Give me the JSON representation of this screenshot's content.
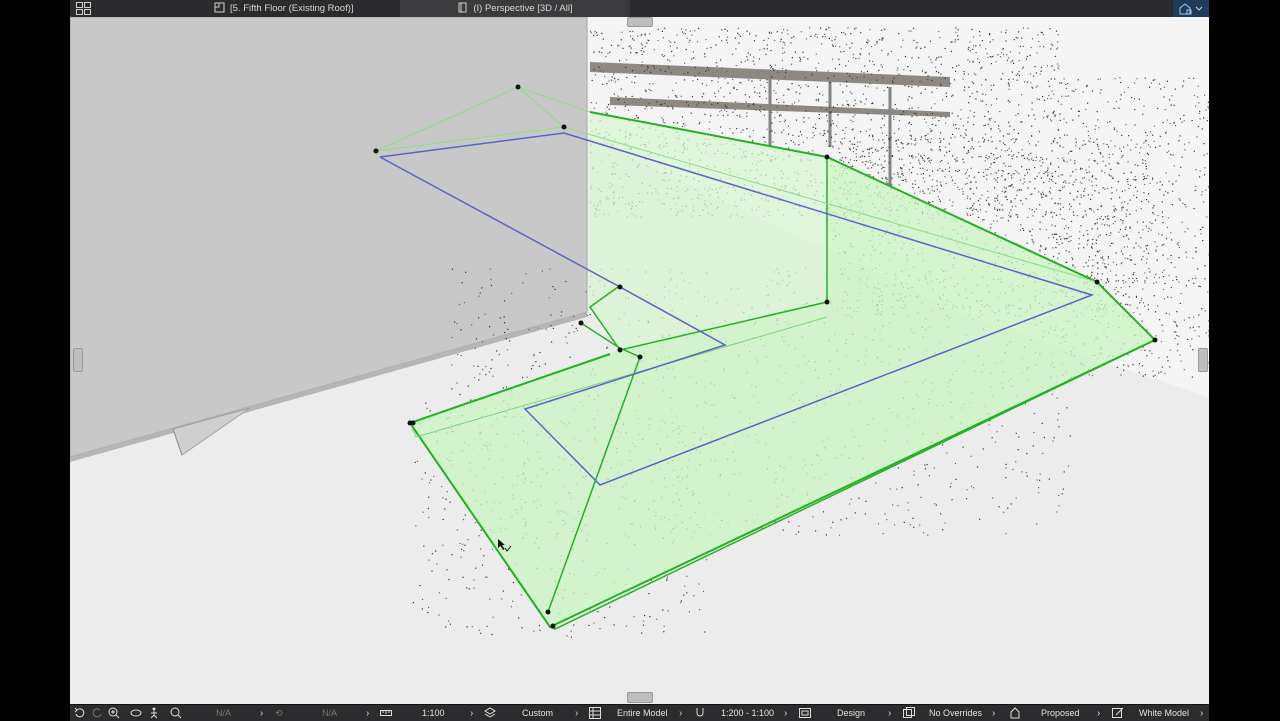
{
  "tabs": [
    {
      "label": "[5. Fifth Floor (Existing Roof)]",
      "icon": "floor-plan-icon"
    },
    {
      "label": "(I) Perspective [3D / All]",
      "icon": "3d-view-icon"
    }
  ],
  "status": {
    "nav1": "N/A",
    "nav2": "N/A",
    "scale": "1:100",
    "layers": "Custom",
    "model_view": "Entire Model",
    "dimension": "1:200 - 1:100",
    "display": "Design",
    "overrides": "No Overrides",
    "renovation": "Proposed",
    "model_style": "White Model"
  },
  "colors": {
    "accent_green": "#22b122",
    "slab_fill": "#c9f5c0",
    "blue_outline": "#5a64c8",
    "wall_gray": "#c8c8c8"
  }
}
